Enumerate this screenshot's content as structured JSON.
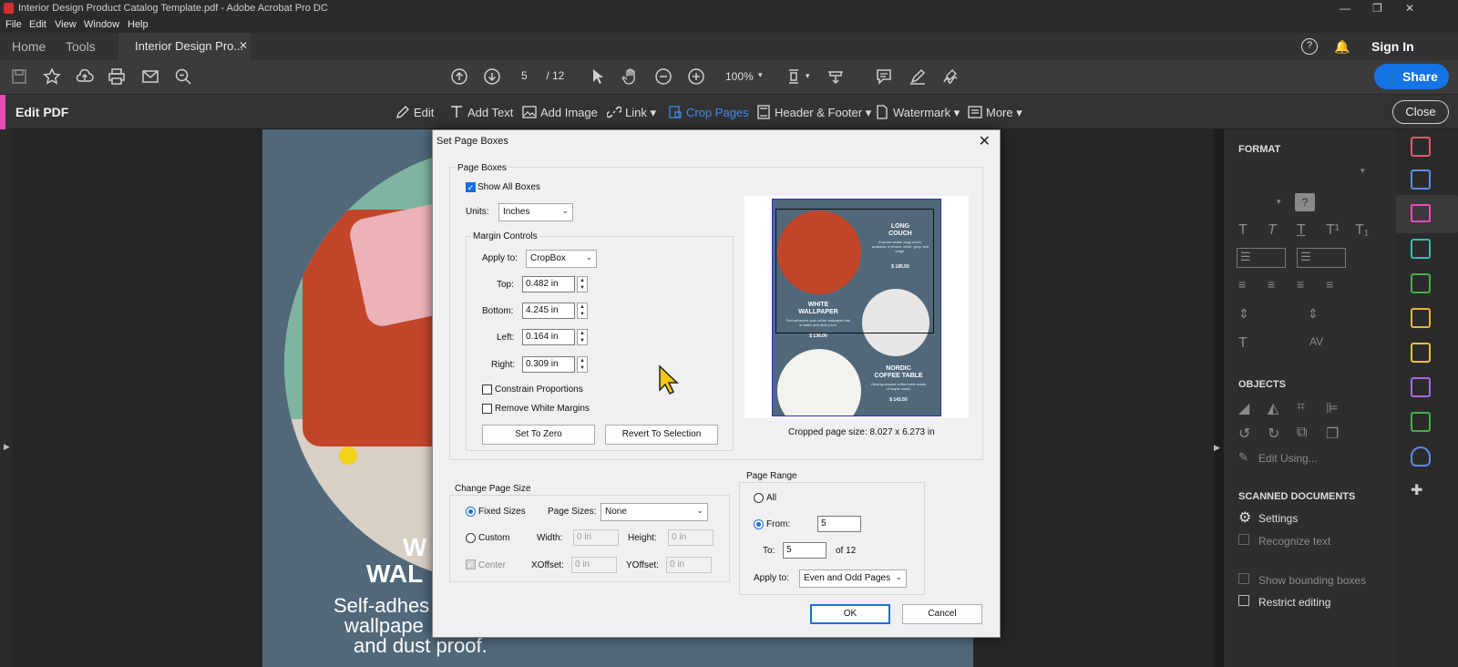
{
  "window": {
    "title": "Interior Design Product Catalog Template.pdf - Adobe Acrobat Pro DC"
  },
  "menu": [
    "File",
    "Edit",
    "View",
    "Window",
    "Help"
  ],
  "tabs": {
    "home": "Home",
    "tools": "Tools",
    "doc": "Interior Design Pro...",
    "sign_in": "Sign In"
  },
  "toolbar": {
    "page_current": "5",
    "page_total": "/ 12",
    "zoom": "100%",
    "share": "Share"
  },
  "editbar": {
    "title": "Edit PDF",
    "items": [
      "Edit",
      "Add Text",
      "Add Image",
      "Link",
      "Crop Pages",
      "Header & Footer",
      "Watermark",
      "More"
    ],
    "close": "Close"
  },
  "page": {
    "heading1": "W",
    "heading2": "WAL",
    "line1": "Self-adhes",
    "line2": "wallpape",
    "line3": "and dust proof."
  },
  "right_panel": {
    "format": "FORMAT",
    "objects": "OBJECTS",
    "edit_using": "Edit Using...",
    "scanned": "SCANNED DOCUMENTS",
    "settings": "Settings",
    "recognize": "Recognize text",
    "bounding": "Show bounding boxes",
    "restrict": "Restrict editing"
  },
  "dialog": {
    "title": "Set Page Boxes",
    "page_boxes": "Page Boxes",
    "show_all": "Show All Boxes",
    "units_label": "Units:",
    "units_value": "Inches",
    "margin_controls": "Margin Controls",
    "apply_to_label": "Apply to:",
    "apply_to_value": "CropBox",
    "top_label": "Top:",
    "top_value": "0.482 in",
    "bottom_label": "Bottom:",
    "bottom_value": "4.245 in",
    "left_label": "Left:",
    "left_value": "0.164 in",
    "right_label": "Right:",
    "right_value": "0.309 in",
    "constrain": "Constrain Proportions",
    "remove_white": "Remove White Margins",
    "set_zero": "Set To Zero",
    "revert": "Revert To Selection",
    "cropped_size": "Cropped page size: 8.027 x 6.273 in",
    "change_size": "Change Page Size",
    "fixed": "Fixed Sizes",
    "page_sizes_label": "Page Sizes:",
    "page_sizes_value": "None",
    "custom": "Custom",
    "width_label": "Width:",
    "width_value": "0 in",
    "height_label": "Height:",
    "height_value": "0 in",
    "center": "Center",
    "xoff_label": "XOffset:",
    "xoff_value": "0 in",
    "yoff_label": "YOffset:",
    "yoff_value": "0 in",
    "page_range": "Page Range",
    "all": "All",
    "from": "From:",
    "from_value": "5",
    "to": "To:",
    "to_value": "5",
    "of": "of 12",
    "range_apply_label": "Apply to:",
    "range_apply_value": "Even and Odd Pages",
    "ok": "OK",
    "cancel": "Cancel"
  },
  "preview": {
    "item1": "LONG\nCOUCH",
    "item1_desc": "A seven seater long couch, available in brown, white, grey, and beige.",
    "item1_price": "$ 185.50",
    "item2": "WHITE\nWALLPAPER",
    "item2_desc": "Self-adhesive plain white wallpaper that is water and dust proof.",
    "item2_price": "$ 136.00",
    "item3": "NORDIC\nCOFFEE TABLE",
    "item3_desc": "Oblong-shaped coffee table made of maple wood.",
    "item3_price": "$ 143.50"
  },
  "colors": {
    "accent_blue": "#1473e6",
    "edit_pink": "#e94cba",
    "page_bg": "#50687a",
    "sofa": "#c2452a"
  }
}
